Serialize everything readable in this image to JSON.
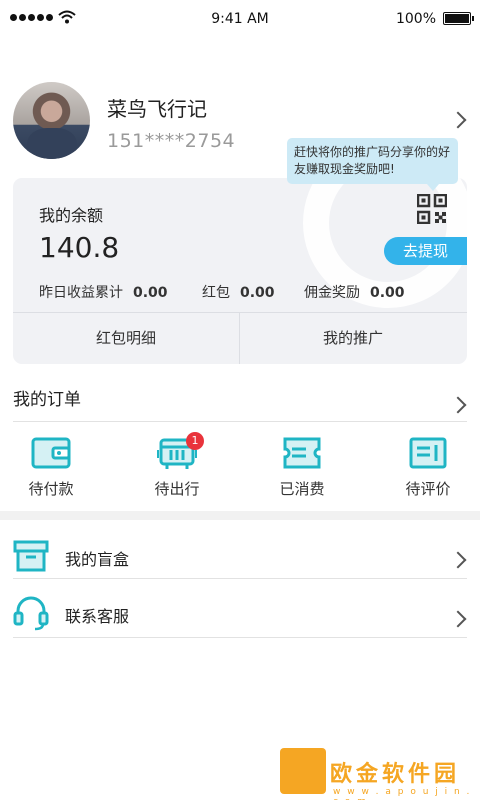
{
  "status_bar": {
    "time": "9:41 AM",
    "battery": "100%"
  },
  "profile": {
    "name": "菜鸟飞行记",
    "phone": "151****2754"
  },
  "tooltip": {
    "text": "赶快将你的推广码分享你的好友赚取现金奖励吧!"
  },
  "balance": {
    "label": "我的余额",
    "value": "140.8",
    "withdraw_label": "去提现",
    "stats": [
      {
        "label": "昨日收益累计",
        "value": "0.00"
      },
      {
        "label": "红包",
        "value": "0.00"
      },
      {
        "label": "佣金奖励",
        "value": "0.00"
      }
    ],
    "buttons": [
      "红包明细",
      "我的推广"
    ]
  },
  "orders": {
    "title": "我的订单",
    "items": [
      {
        "label": "待付款",
        "icon": "wallet-icon"
      },
      {
        "label": "待出行",
        "icon": "bus-icon",
        "badge": "1"
      },
      {
        "label": "已消费",
        "icon": "ticket-icon"
      },
      {
        "label": "待评价",
        "icon": "comment-icon"
      }
    ]
  },
  "menu": [
    {
      "label": "我的盲盒",
      "icon": "box-icon"
    },
    {
      "label": "联系客服",
      "icon": "headset-icon"
    }
  ],
  "watermark": {
    "text": "欧金软件园",
    "url": "w w w . a p o u j i n . c o m"
  },
  "colors": {
    "accent": "#33b3ea",
    "icon_teal": "#1fb5c4",
    "badge": "#e9333b"
  }
}
